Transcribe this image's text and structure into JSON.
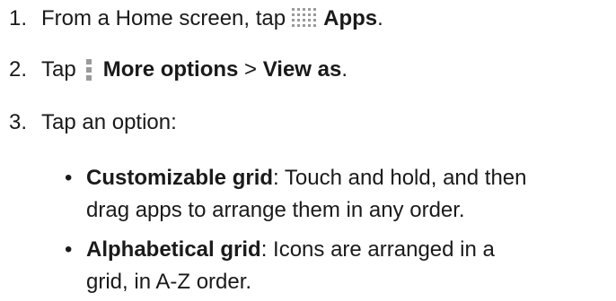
{
  "steps": [
    {
      "number": "1.",
      "text_before": "From a Home screen, tap",
      "icon": "apps-grid-icon",
      "bold": "Apps",
      "text_after": "."
    },
    {
      "number": "2.",
      "text_before": "Tap",
      "icon": "more-options-icon",
      "bold": "More options",
      "separator": " > ",
      "bold2": "View as",
      "text_after": "."
    },
    {
      "number": "3.",
      "text_before": "Tap an option:"
    }
  ],
  "options": [
    {
      "term": "Customizable grid",
      "line1": ": Touch and hold, and then",
      "line2": "drag apps to arrange them in any order."
    },
    {
      "term": "Alphabetical grid",
      "line1": ": Icons are arranged in a",
      "line2": "grid, in A-Z order."
    }
  ],
  "bullet_glyph": "•",
  "colors": {
    "text": "#1a1a1a",
    "icon": "#9a9a9a"
  }
}
